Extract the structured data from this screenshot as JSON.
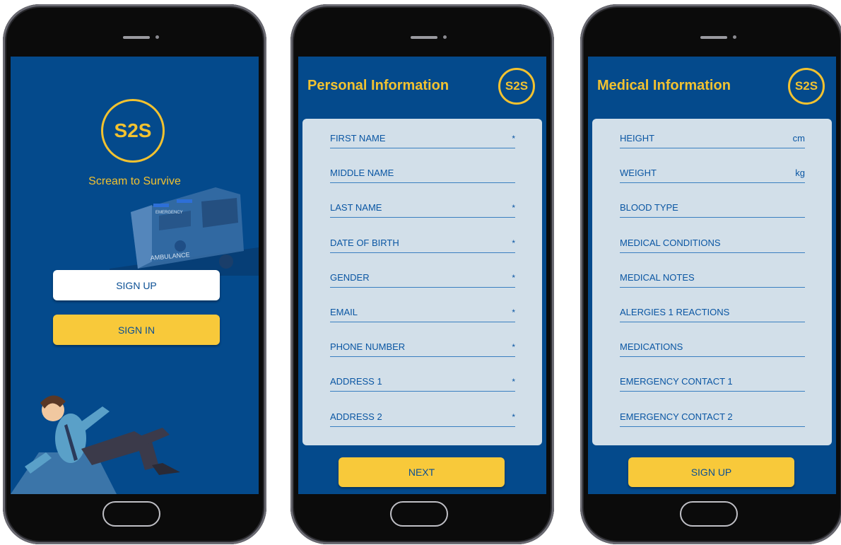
{
  "colors": {
    "screen_bg": "#044a8c",
    "accent_yellow": "#f2c230",
    "button_yellow": "#f8c93a",
    "card_bg": "#d2dfe9",
    "label_blue": "#0a56a3"
  },
  "welcome": {
    "logo": "S2S",
    "tagline": "Scream to Survive",
    "signup_label": "SIGN UP",
    "signin_label": "SIGN IN",
    "ambulance_text": "AMBULANCE",
    "ambulance_roof_text": "EMERGENCY"
  },
  "personal": {
    "title": "Personal Information",
    "logo": "S2S",
    "fields": [
      {
        "label": "FIRST NAME",
        "mark": "*"
      },
      {
        "label": "MIDDLE NAME",
        "mark": ""
      },
      {
        "label": "LAST NAME",
        "mark": "*"
      },
      {
        "label": "DATE OF BIRTH",
        "mark": "*"
      },
      {
        "label": "GENDER",
        "mark": "*"
      },
      {
        "label": "EMAIL",
        "mark": "*"
      },
      {
        "label": "PHONE NUMBER",
        "mark": "*"
      },
      {
        "label": "ADDRESS 1",
        "mark": "*"
      },
      {
        "label": "ADDRESS 2",
        "mark": "*"
      }
    ],
    "next_label": "NEXT"
  },
  "medical": {
    "title": "Medical Information",
    "logo": "S2S",
    "fields": [
      {
        "label": "HEIGHT",
        "unit": "cm"
      },
      {
        "label": "WEIGHT",
        "unit": "kg"
      },
      {
        "label": "BLOOD TYPE",
        "unit": ""
      },
      {
        "label": "MEDICAL CONDITIONS",
        "unit": ""
      },
      {
        "label": "MEDICAL NOTES",
        "unit": ""
      },
      {
        "label": "ALERGIES 1 REACTIONS",
        "unit": ""
      },
      {
        "label": "MEDICATIONS",
        "unit": ""
      },
      {
        "label": "EMERGENCY CONTACT 1",
        "unit": ""
      },
      {
        "label": "EMERGENCY CONTACT 2",
        "unit": ""
      }
    ],
    "signup_label": "SIGN UP"
  }
}
